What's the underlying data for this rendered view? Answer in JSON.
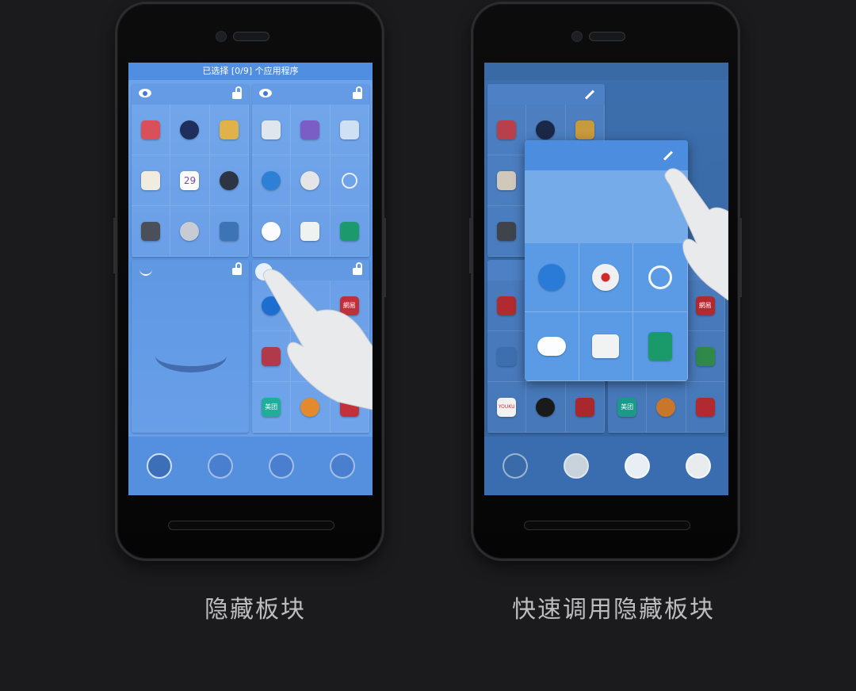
{
  "left_screen": {
    "status_text": "已选择 [0/9] 个应用程序",
    "caption": "隐藏板块"
  },
  "right_screen": {
    "caption": "快速调用隐藏板块"
  },
  "panels": [
    {
      "name": "top-left",
      "visible": true,
      "icons": [
        "toolbox-icon",
        "camera-icon",
        "photos-icon",
        "notes-icon",
        "calendar-icon",
        "clock-icon",
        "music-icon",
        "steering-icon",
        "gallery-icon"
      ]
    },
    {
      "name": "top-right",
      "visible": true,
      "icons": [
        "calculator-icon",
        "game-icon",
        "brightness-icon",
        "umbrella-icon",
        "cd-icon",
        "search-icon",
        "cloud-icon",
        "download-icon",
        "book-icon"
      ]
    },
    {
      "name": "bottom-left",
      "visible": false,
      "icons": [
        "app-icon",
        "app-icon",
        "app-icon",
        "app-icon",
        "app-icon",
        "app-icon",
        "app-icon",
        "app-icon",
        "app-icon"
      ]
    },
    {
      "name": "bottom-right",
      "visible": true,
      "icons": [
        "dolphin-icon",
        "app-icon",
        "netease-icon",
        "flickr-icon",
        "app-icon",
        "app-icon",
        "meituan-icon",
        "kuwo-icon",
        "ticket-icon"
      ]
    }
  ],
  "calendar_day": "29",
  "meituan_label": "美团",
  "netease_label": "網易",
  "youku_label": "YOUKU",
  "colors": {
    "accent": "#5a94e3",
    "background": "#1b1b1d"
  }
}
